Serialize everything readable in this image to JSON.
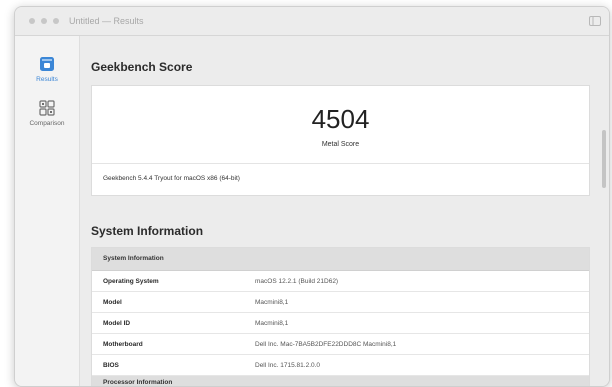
{
  "window": {
    "title": "Untitled — Results"
  },
  "sidebar": {
    "items": [
      {
        "label": "Results",
        "icon": "results-icon",
        "selected": true
      },
      {
        "label": "Comparison",
        "icon": "comparison-icon",
        "selected": false
      }
    ]
  },
  "score_section": {
    "title": "Geekbench Score",
    "score": "4504",
    "score_label": "Metal Score",
    "version": "Geekbench 5.4.4 Tryout for macOS x86 (64-bit)"
  },
  "system_section": {
    "title": "System Information",
    "table_header": "System Information",
    "rows": [
      {
        "label": "Operating System",
        "value": "macOS 12.2.1 (Build 21D62)"
      },
      {
        "label": "Model",
        "value": "Macmini8,1"
      },
      {
        "label": "Model ID",
        "value": "Macmini8,1"
      },
      {
        "label": "Motherboard",
        "value": "Dell Inc. Mac-7BA5B2DFE22DDD8C Macmini8,1"
      },
      {
        "label": "BIOS",
        "value": "Dell Inc. 1715.81.2.0.0"
      }
    ],
    "next_header": "Processor Information"
  },
  "colors": {
    "accent": "#3b86d6",
    "window_bg": "#ececec",
    "card_bg": "#ffffff",
    "table_header_bg": "#dedede"
  }
}
